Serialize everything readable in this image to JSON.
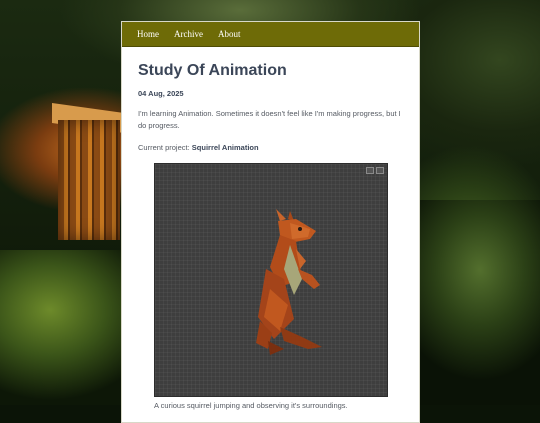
{
  "nav": {
    "items": [
      {
        "label": "Home"
      },
      {
        "label": "Archive"
      },
      {
        "label": "About"
      }
    ]
  },
  "post": {
    "title": "Study Of Animation",
    "date": "04 Aug, 2025",
    "intro": "I'm learning Animation. Sometimes it doesn't feel like I'm making progress, but I do progress.",
    "project_prefix": "Current project: ",
    "project_name": "Squirrel Animation",
    "caption": "A curious squirrel jumping and observing it's surroundings."
  },
  "colors": {
    "nav_bg": "#6e6b07",
    "title": "#3b4658",
    "squirrel_main": "#b8521f",
    "squirrel_belly": "#a7a679"
  },
  "icons": {
    "video_controls": [
      "fullscreen-icon",
      "close-icon"
    ]
  }
}
